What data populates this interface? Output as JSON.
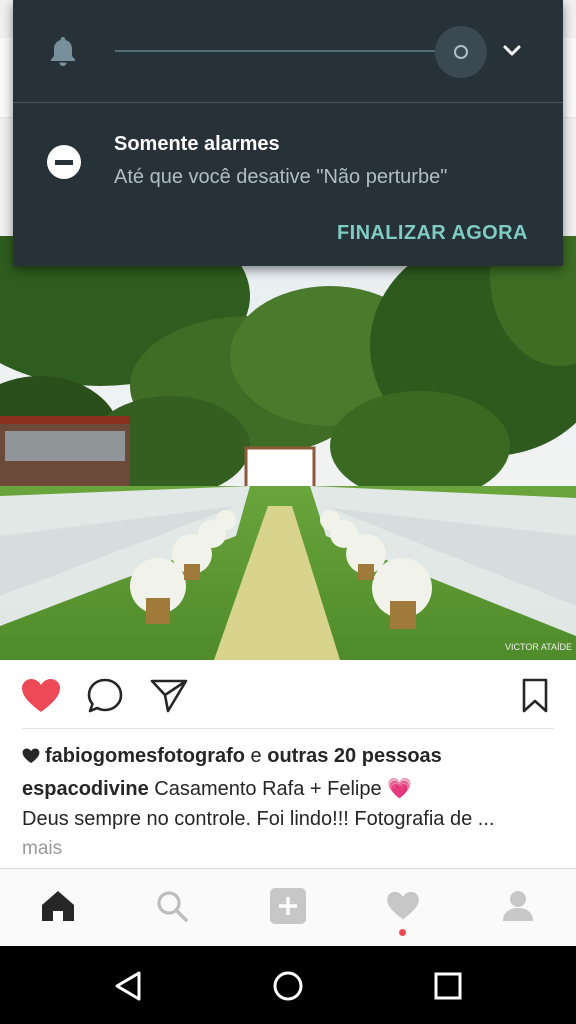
{
  "notification_shade": {
    "bell_icon": "bell-icon",
    "dnd_icon": "do-not-disturb-icon",
    "dnd_title": "Somente alarmes",
    "dnd_subtitle": "Até que você desative \"Não perturbe\"",
    "dnd_action": "FINALIZAR AGORA",
    "colors": {
      "background": "#263238",
      "action": "#80cbc4"
    }
  },
  "post": {
    "image": "wedding-ceremony-outdoor-photo",
    "watermark": "VICTOR ATAÍDE",
    "actions": [
      "heart-filled-icon",
      "comment-icon",
      "share-icon",
      "bookmark-icon"
    ],
    "liked_by_user": "fabiogomesfotografo",
    "liked_connector": " e ",
    "liked_others": "outras 20 pessoas",
    "caption_user": "espacodivine",
    "caption_text": " Casamento Rafa + Felipe ",
    "caption_emoji": "💗",
    "caption_line2": "Deus sempre no controle. Foi lindo!!! Fotografia de ...",
    "more_label": "mais",
    "colors": {
      "like": "#ed4956",
      "emoji": "#e05599"
    }
  },
  "tabbar": {
    "tabs": [
      "home-icon",
      "search-icon",
      "add-icon",
      "activity-icon",
      "profile-icon"
    ],
    "activity_dot_color": "#ed4956"
  },
  "system_nav": [
    "back-icon",
    "home-circle-icon",
    "recents-icon"
  ]
}
